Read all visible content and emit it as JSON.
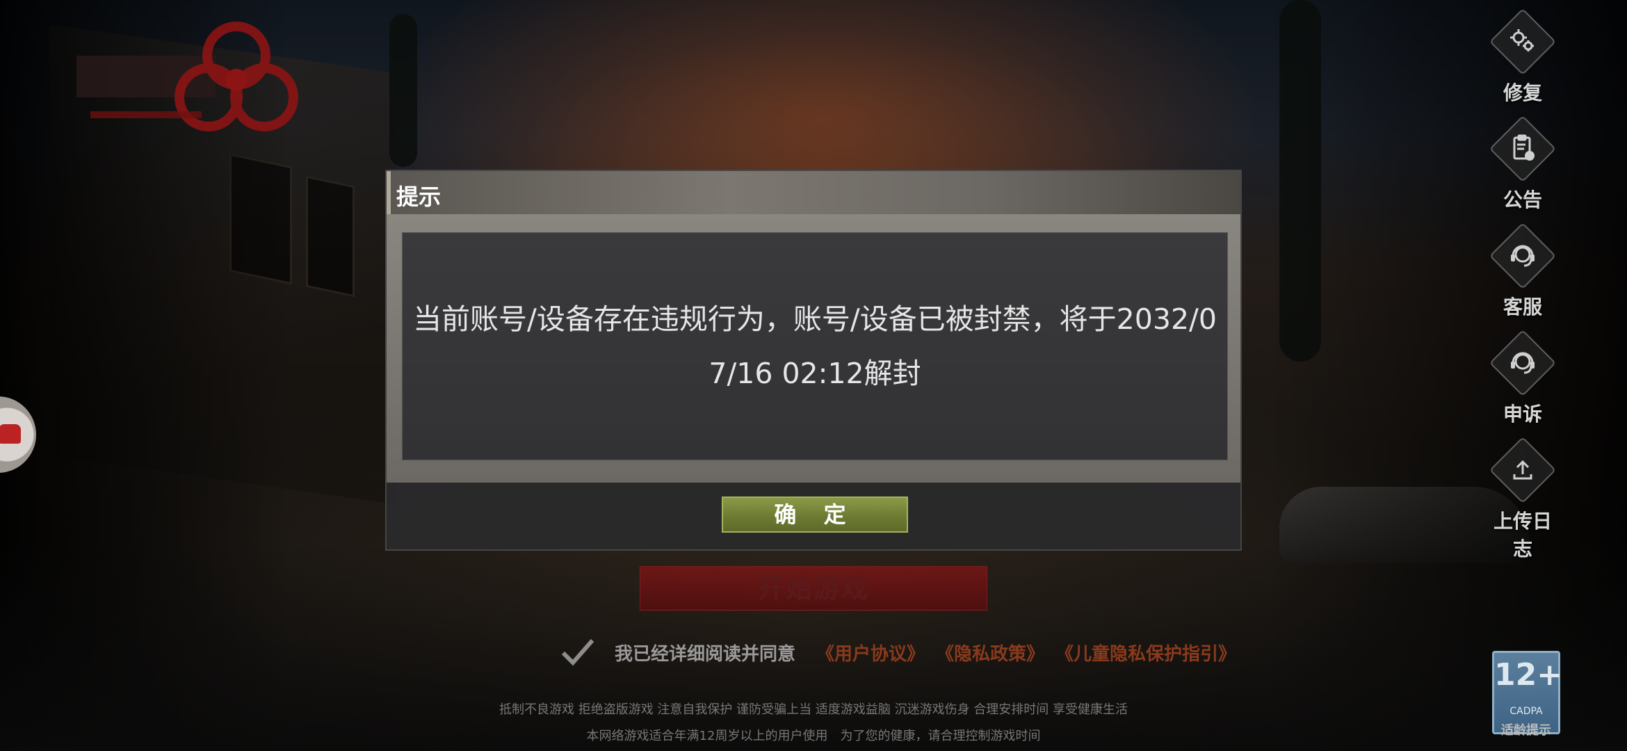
{
  "dialog": {
    "title": "提示",
    "message": "当前账号/设备存在违规行为，账号/设备已被封禁，将于2032/07/16 02:12解封",
    "confirm_label": "确 定"
  },
  "side_menu": [
    {
      "label": "修复",
      "icon": "gears-icon"
    },
    {
      "label": "公告",
      "icon": "clipboard-announcement-icon"
    },
    {
      "label": "客服",
      "icon": "headset-icon"
    },
    {
      "label": "申诉",
      "icon": "headset-icon"
    },
    {
      "label": "上传日志",
      "icon": "upload-icon"
    }
  ],
  "start_button_label": "开始游戏",
  "agreement": {
    "text": "我已经详细阅读并同意",
    "links": [
      "《用户协议》",
      "《隐私政策》",
      "《儿童隐私保护指引》"
    ]
  },
  "health_notice": {
    "line1": "抵制不良游戏 拒绝盗版游戏 注意自我保护 谨防受骗上当 适度游戏益脑 沉迷游戏伤身 合理安排时间 享受健康生活",
    "line2": "本网络游戏适合年满12周岁以上的用户使用　为了您的健康，请合理控制游戏时间"
  },
  "age_badge": {
    "rating": "12+",
    "org": "CADPA",
    "caption": "适龄提示"
  },
  "colors": {
    "confirm_button": "#6d7c33",
    "start_button": "#7a1616",
    "link": "#8a3a1c"
  }
}
